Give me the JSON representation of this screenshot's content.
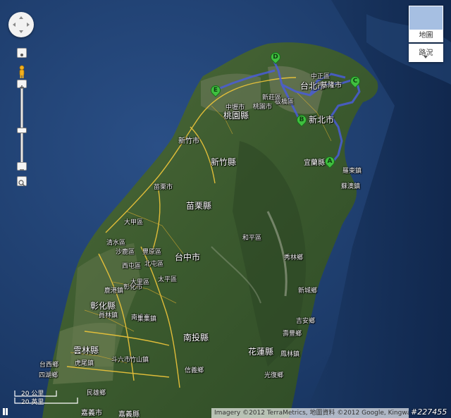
{
  "map": {
    "map_type_label": "地圖",
    "traffic_label": "路況",
    "scale_km": "20 公里",
    "scale_mi": "20 英里",
    "attribution": "Imagery ©2012 TerraMetrics, 地圖資料 ©2012 Google, Kingway, ZENRIN",
    "watermark": "#227455"
  },
  "places": [
    {
      "id": "taipei",
      "text": "台北市",
      "size": "l"
    },
    {
      "id": "xinbei",
      "text": "新北市",
      "size": "l"
    },
    {
      "id": "taoyuan",
      "text": "桃園縣",
      "size": "l"
    },
    {
      "id": "keelung",
      "text": "基隆市",
      "size": "m"
    },
    {
      "id": "hsinchu-city",
      "text": "新竹市",
      "size": "m"
    },
    {
      "id": "hsinchu-county",
      "text": "新竹縣",
      "size": "l"
    },
    {
      "id": "miaoli-county",
      "text": "苗栗縣",
      "size": "l"
    },
    {
      "id": "miaoli-city",
      "text": "苗栗市",
      "size": "s"
    },
    {
      "id": "yilan-county",
      "text": "宜蘭縣",
      "size": "m"
    },
    {
      "id": "luodong",
      "text": "羅東鎮",
      "size": "s"
    },
    {
      "id": "suao",
      "text": "蘇澳鎮",
      "size": "s"
    },
    {
      "id": "taichung",
      "text": "台中市",
      "size": "l"
    },
    {
      "id": "changhua-county",
      "text": "彰化縣",
      "size": "l"
    },
    {
      "id": "changhua-city",
      "text": "彰化市",
      "size": "s"
    },
    {
      "id": "nantou-county",
      "text": "南投縣",
      "size": "l"
    },
    {
      "id": "nantou-city",
      "text": "南投市",
      "size": "s"
    },
    {
      "id": "yunlin",
      "text": "雲林縣",
      "size": "l"
    },
    {
      "id": "huwei",
      "text": "虎尾鎮",
      "size": "s"
    },
    {
      "id": "douliu",
      "text": "斗六市",
      "size": "s"
    },
    {
      "id": "hualien-county",
      "text": "花蓮縣",
      "size": "l"
    },
    {
      "id": "xiulin",
      "text": "秀林鄉",
      "size": "s"
    },
    {
      "id": "xincheng",
      "text": "新城鄉",
      "size": "s"
    },
    {
      "id": "jian",
      "text": "吉安鄉",
      "size": "s"
    },
    {
      "id": "shoufeng",
      "text": "壽豐鄉",
      "size": "s"
    },
    {
      "id": "fenglin",
      "text": "鳳林鎮",
      "size": "s"
    },
    {
      "id": "guangfu",
      "text": "光復鄉",
      "size": "s"
    },
    {
      "id": "heping",
      "text": "和平區",
      "size": "s"
    },
    {
      "id": "fengyuan",
      "text": "豐原區",
      "size": "s"
    },
    {
      "id": "beitun",
      "text": "北屯區",
      "size": "s"
    },
    {
      "id": "xitun",
      "text": "西屯區",
      "size": "s"
    },
    {
      "id": "dali",
      "text": "大里區",
      "size": "s"
    },
    {
      "id": "taiping",
      "text": "太平區",
      "size": "s"
    },
    {
      "id": "qingshui",
      "text": "清水區",
      "size": "s"
    },
    {
      "id": "shalu",
      "text": "沙鹿區",
      "size": "s"
    },
    {
      "id": "dajia",
      "text": "大甲區",
      "size": "s"
    },
    {
      "id": "yuanlin",
      "text": "員林鎮",
      "size": "s"
    },
    {
      "id": "jiji",
      "text": "集集鎮",
      "size": "s"
    },
    {
      "id": "zhushan",
      "text": "竹山鎮",
      "size": "s"
    },
    {
      "id": "xinyi",
      "text": "信義鄉",
      "size": "s"
    },
    {
      "id": "chiayi-city",
      "text": "嘉義市",
      "size": "m"
    },
    {
      "id": "chiayi-county",
      "text": "嘉義縣",
      "size": "m"
    },
    {
      "id": "minxiong",
      "text": "民雄鄉",
      "size": "s"
    },
    {
      "id": "taixi",
      "text": "台西鄉",
      "size": "s"
    },
    {
      "id": "sihu",
      "text": "四湖鄉",
      "size": "s"
    },
    {
      "id": "banqiao",
      "text": "板橋區",
      "size": "s"
    },
    {
      "id": "xinzhuang",
      "text": "新莊區",
      "size": "s"
    },
    {
      "id": "zhongzheng",
      "text": "中正區",
      "size": "s"
    },
    {
      "id": "taoyuan-city",
      "text": "桃園市",
      "size": "s"
    },
    {
      "id": "zhongli",
      "text": "中壢市",
      "size": "s"
    },
    {
      "id": "lugang",
      "text": "鹿港鎮",
      "size": "s"
    }
  ],
  "markers": [
    {
      "id": "A",
      "label": "A"
    },
    {
      "id": "B",
      "label": "B"
    },
    {
      "id": "C",
      "label": "C"
    },
    {
      "id": "D",
      "label": "D"
    },
    {
      "id": "E",
      "label": "E"
    }
  ]
}
